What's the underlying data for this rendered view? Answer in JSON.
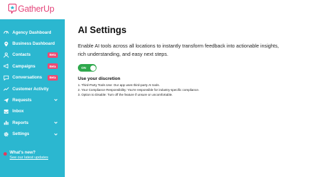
{
  "brand": {
    "name": "GatherUp",
    "color": "#e4457a"
  },
  "sidebar": {
    "background": "#2bb7d0",
    "items": [
      {
        "label": "Agency Dashboard",
        "icon": "gauge-icon"
      },
      {
        "label": "Business Dashboard",
        "icon": "map-pin-icon"
      },
      {
        "label": "Contacts",
        "icon": "user-icon",
        "badge": "Beta"
      },
      {
        "label": "Campaigns",
        "icon": "megaphone-icon",
        "badge": "Beta"
      },
      {
        "label": "Conversations",
        "icon": "chat-icon",
        "badge": "Beta"
      },
      {
        "label": "Customer Activity",
        "icon": "trend-icon"
      },
      {
        "label": "Requests",
        "icon": "paper-plane-icon",
        "expandable": true
      },
      {
        "label": "Inbox",
        "icon": "inbox-icon"
      },
      {
        "label": "Reports",
        "icon": "bar-chart-icon",
        "expandable": true
      },
      {
        "label": "Settings",
        "icon": "gear-icon",
        "expandable": true
      }
    ],
    "whats_new": {
      "title": "What's new?",
      "link": "See our latest updates"
    }
  },
  "main": {
    "title": "AI Settings",
    "description": "Enable AI tools across all locations to instantly transform feedback into actionable insights, rich understanding, and easy next steps.",
    "toggle": {
      "label": "ON",
      "state": "on",
      "color": "#2ea84c"
    },
    "discretion": {
      "title": "Use your discretion",
      "items": [
        "1. Third-Party Tools Use: Our app uses third-party AI tools.",
        "2. Your Compliance Responsibility: You're responsible for industry-specific compliance.",
        "3. Option to Disable: Turn off the feature if unsure or uncomfortable."
      ]
    }
  }
}
